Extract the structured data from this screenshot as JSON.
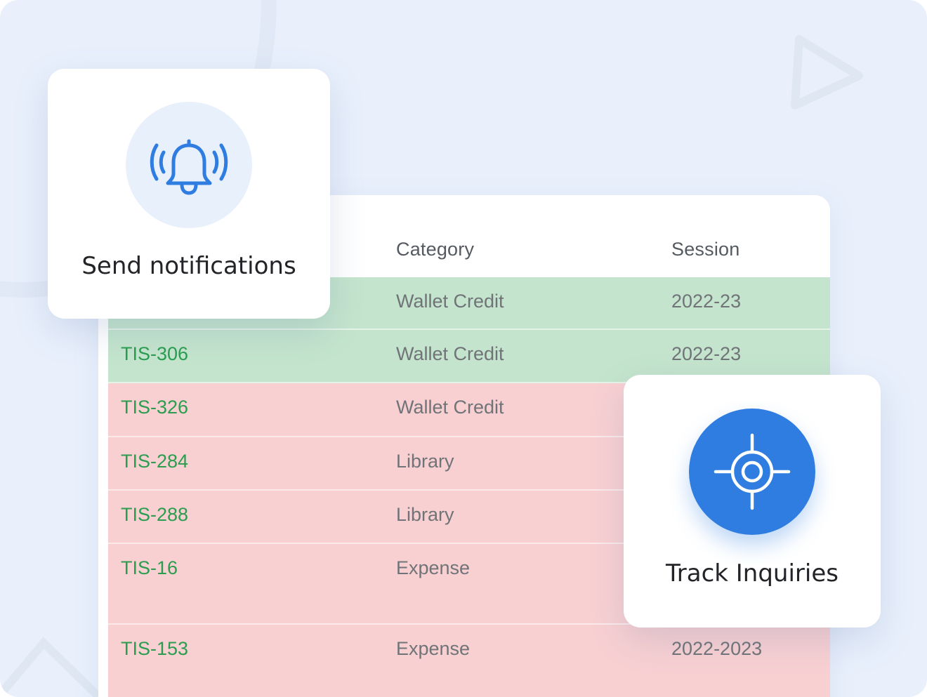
{
  "notify_card": {
    "title": "Send notifications",
    "icon": "bell-ringing-icon"
  },
  "track_card": {
    "title": "Track Inquiries",
    "icon": "crosshair-target-icon"
  },
  "table": {
    "headers": {
      "category": "Category",
      "session": "Session"
    },
    "rows": [
      {
        "id": "",
        "category": "Wallet Credit",
        "session": "2022-23",
        "status": "green"
      },
      {
        "id": "TIS-306",
        "category": "Wallet Credit",
        "session": "2022-23",
        "status": "green"
      },
      {
        "id": "TIS-326",
        "category": "Wallet Credit",
        "session": "",
        "status": "red"
      },
      {
        "id": "TIS-284",
        "category": "Library",
        "session": "",
        "status": "red"
      },
      {
        "id": "TIS-288",
        "category": "Library",
        "session": "",
        "status": "red"
      },
      {
        "id": "TIS-16",
        "category": "Expense",
        "session": "",
        "status": "red"
      },
      {
        "id": "TIS-153",
        "category": "Expense",
        "session": "2022-2023",
        "status": "red"
      }
    ]
  },
  "colors": {
    "background": "#e9f0fc",
    "accent_blue": "#2f7de1",
    "row_green": "#c4e4cd",
    "row_red": "#f8d0d2",
    "id_text_green": "#2a9d4f"
  }
}
